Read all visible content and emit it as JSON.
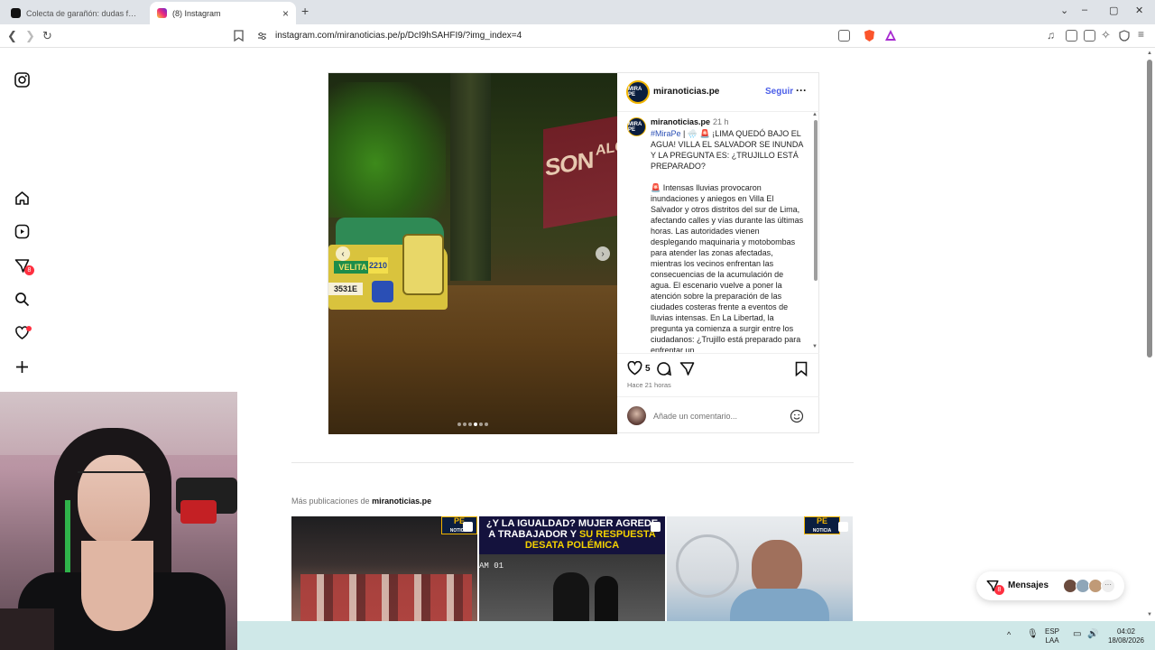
{
  "browser": {
    "tabs": [
      {
        "title": "Colecta de garañón: dudas frecuente",
        "active": false
      },
      {
        "title": "(8) Instagram",
        "active": true
      }
    ],
    "url": "instagram.com/miranoticias.pe/p/DcI9hSAHFI9/?img_index=4"
  },
  "rail": {
    "messages_badge": "8"
  },
  "post": {
    "username": "miranoticias.pe",
    "follow_label": "Seguir",
    "more_label": "···",
    "caption_user": "miranoticias.pe",
    "caption_time": "21 h",
    "caption_hashtag": "#MiraPe",
    "caption_head": " | 🌧️ 🚨 ¡LIMA QUEDÓ BAJO EL AGUA! VILLA EL SALVADOR SE INUNDA Y LA PREGUNTA ES: ¿TRUJILLO ESTÁ PREPARADO?",
    "caption_body": "🚨 Intensas lluvias provocaron inundaciones y aniegos en Villa El Salvador y otros distritos del sur de Lima, afectando calles y vías durante las últimas horas. Las autoridades vienen desplegando maquinaria y motobombas para atender las zonas afectadas, mientras los vecinos enfrentan las consecuencias de la acumulación de agua. El escenario vuelve a poner la atención sobre la preparación de las ciudades costeras frente a eventos de lluvias intensas. En La Libertad, la pregunta ya comienza a surgir entre los ciudadanos: ¿Trujillo está preparado para enfrentar un",
    "likes": "5",
    "time_ago": "Hace 21 horas",
    "comment_placeholder": "Añade un comentario...",
    "avatar_text": "MIRA PE",
    "photo_sign_1": "SON",
    "photo_sign_2": "ALCA",
    "photo_plate": "3531E",
    "photo_number": "2210",
    "photo_text": "VELITA"
  },
  "more_posts": {
    "label_prefix": "Más publicaciones de ",
    "label_user": "miranoticias.pe",
    "thumb_logo": "PE",
    "thumb_logo_sub": "NOTICIA",
    "thumb2_line1": "¿Y LA IGUALDAD? MUJER AGREDE",
    "thumb2_line2a": "A TRABAJADOR Y ",
    "thumb2_line2b": "SU RESPUESTA",
    "thumb2_line3": "DESATA POLÉMICA",
    "thumb2_cam": "AM 01"
  },
  "messages": {
    "label": "Mensajes",
    "badge": "8"
  },
  "taskbar": {
    "lang": "ESP",
    "region": "LAA",
    "time": "04:02",
    "date": "18/08/2026"
  },
  "colors": {
    "accent": "#4a5de8",
    "badge": "#ff3040",
    "taskbar": "#cfe8e8"
  }
}
